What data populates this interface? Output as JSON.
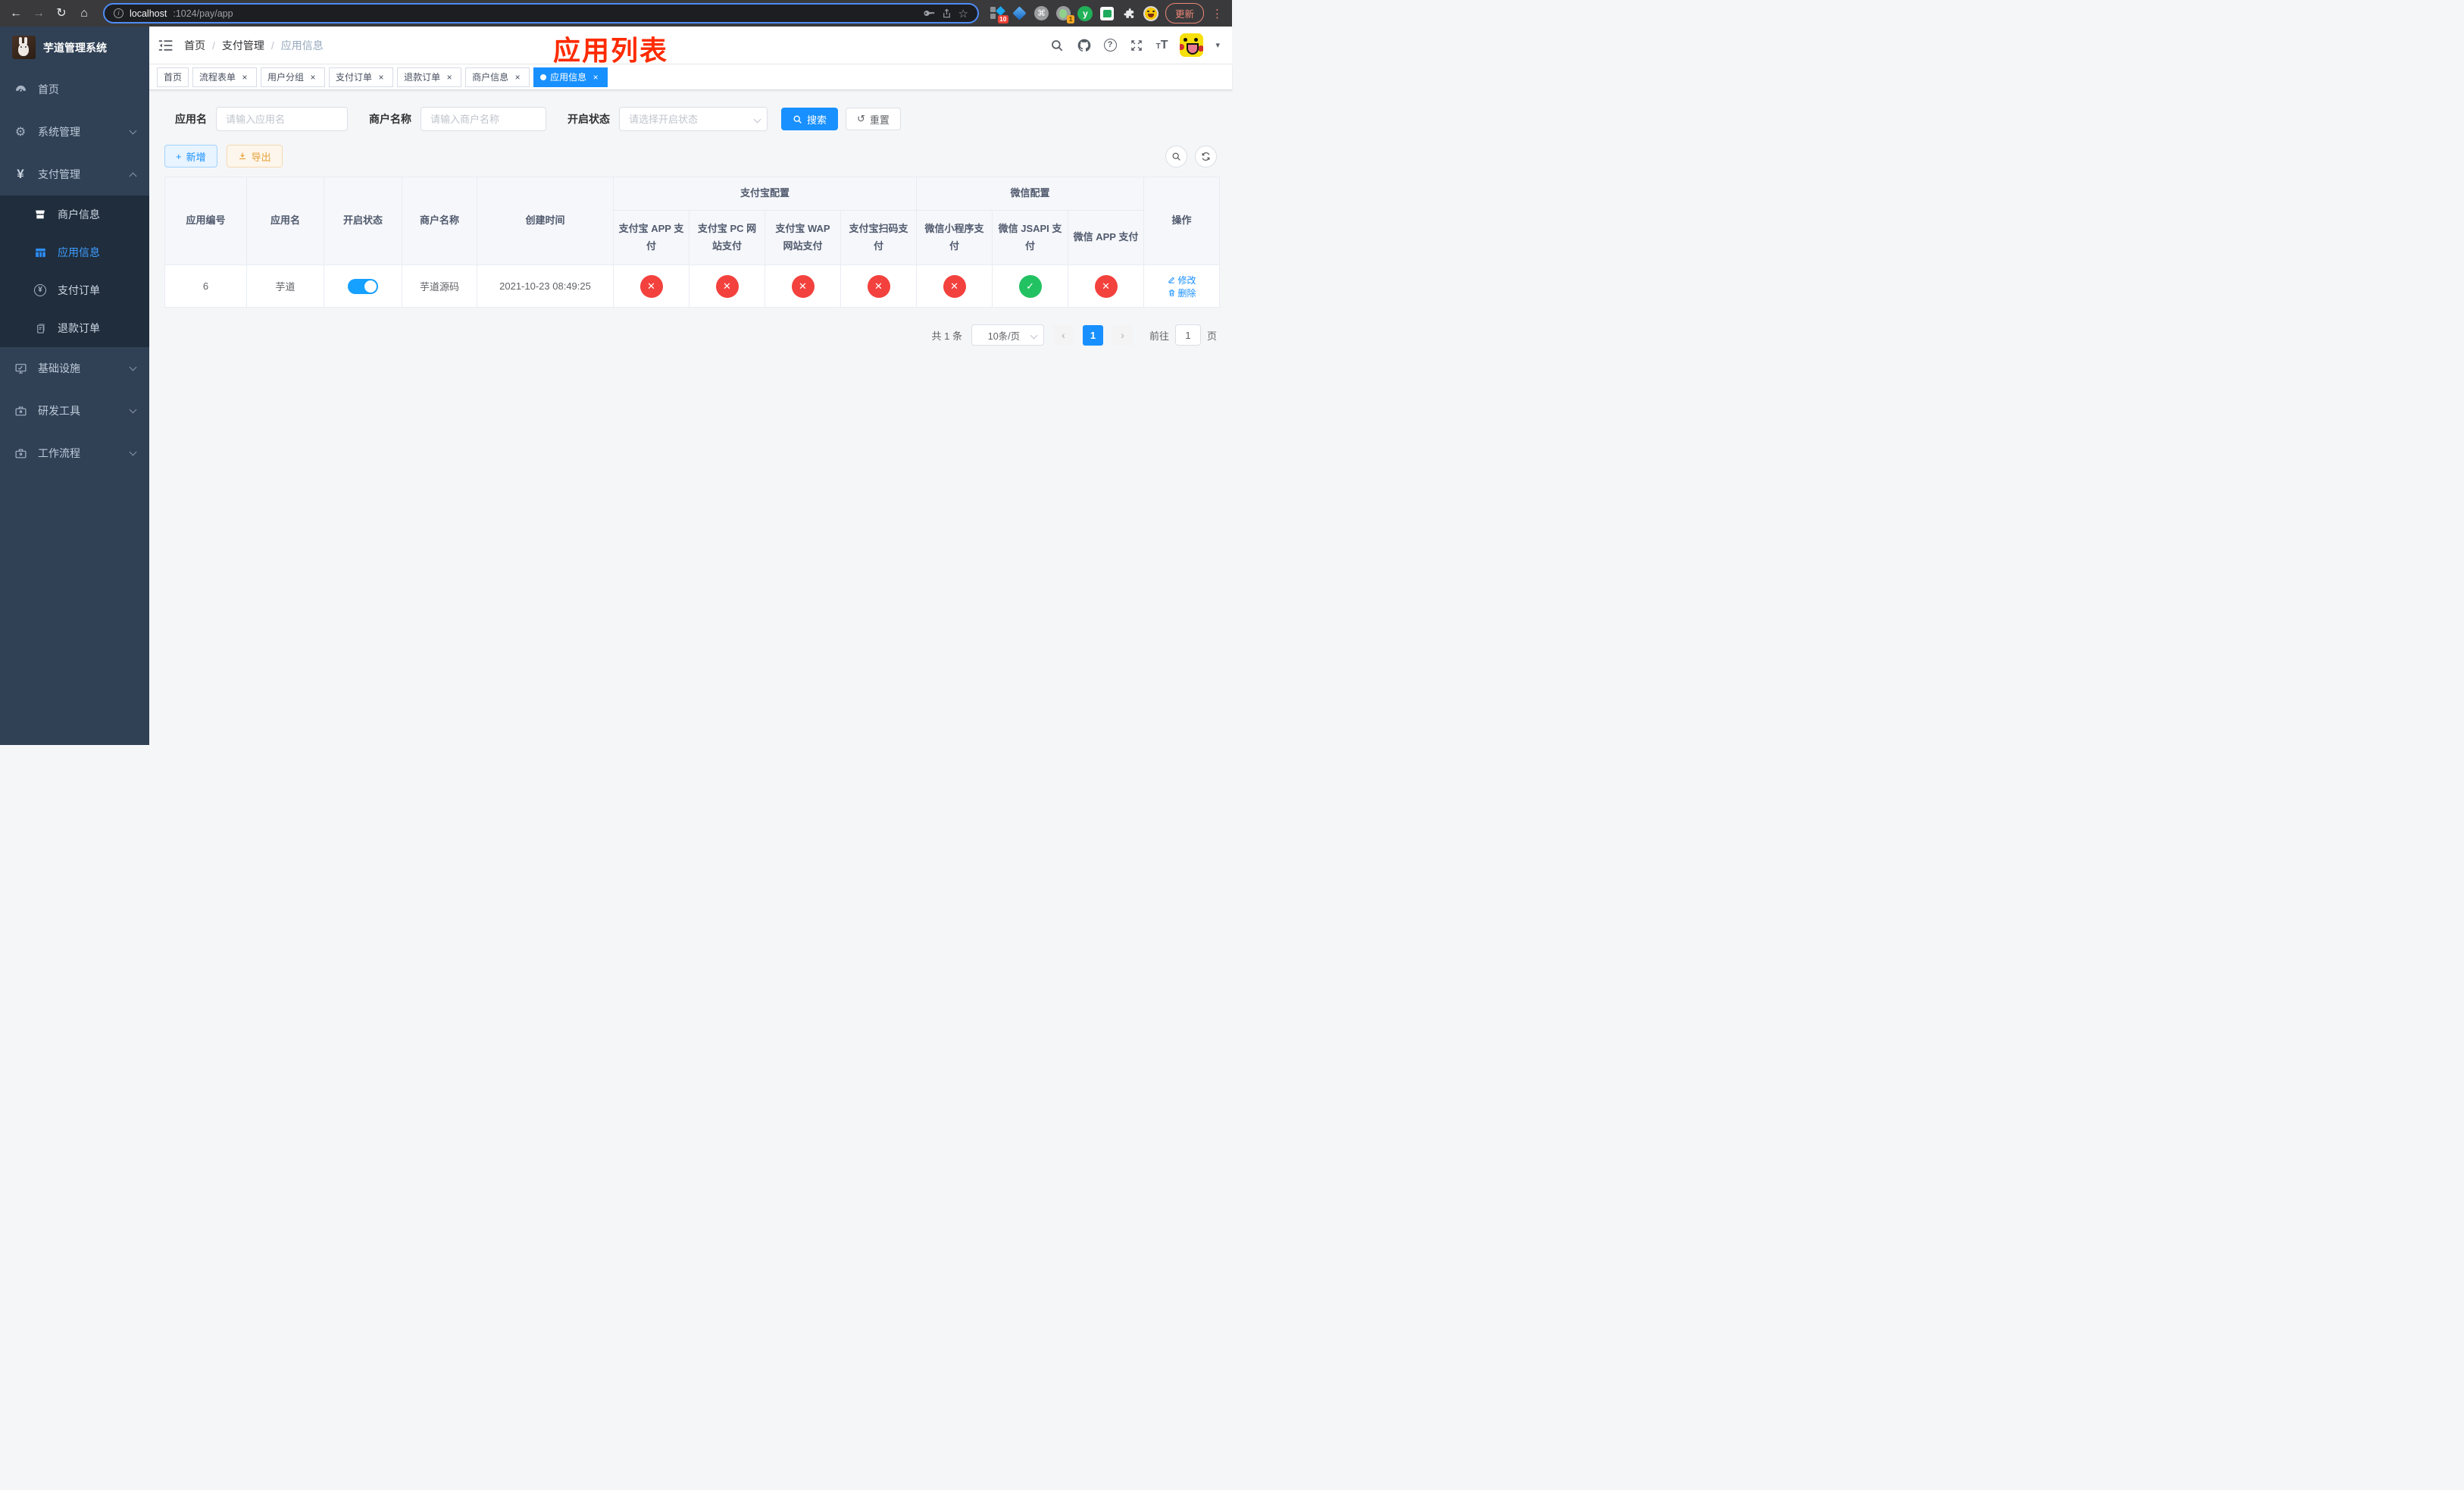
{
  "browser": {
    "url_host": "localhost",
    "url_path": ":1024/pay/app",
    "update_label": "更新",
    "ext_badge_grid": "10",
    "ext_badge_session": "1",
    "ext_y_letter": "y"
  },
  "icons": {
    "back": "←",
    "forward": "→",
    "refresh": "↻",
    "home": "⌂",
    "star": "☆",
    "cmd": "⌘",
    "kebab": "⋮",
    "caret_down": "▾",
    "info": "i",
    "help": "?",
    "close": "×",
    "check": "✓",
    "cross": "✕",
    "plus": "+",
    "reset": "↺",
    "prev": "‹",
    "next": "›",
    "yen": "¥"
  },
  "sidebar": {
    "title": "芋道管理系统",
    "items": [
      {
        "label": "首页",
        "icon": "dashboard-icon"
      },
      {
        "label": "系统管理",
        "icon": "gear-icon"
      },
      {
        "label": "支付管理",
        "icon": "yen-icon"
      },
      {
        "label": "基础设施",
        "icon": "monitor-icon"
      },
      {
        "label": "研发工具",
        "icon": "briefcase-icon"
      },
      {
        "label": "工作流程",
        "icon": "briefcase-icon"
      }
    ],
    "pay_children": [
      {
        "label": "商户信息"
      },
      {
        "label": "应用信息"
      },
      {
        "label": "支付订单"
      },
      {
        "label": "退款订单"
      }
    ]
  },
  "header": {
    "breadcrumb": [
      "首页",
      "支付管理",
      "应用信息"
    ],
    "annotation": "应用列表"
  },
  "tabs": [
    {
      "label": "首页"
    },
    {
      "label": "流程表单"
    },
    {
      "label": "用户分组"
    },
    {
      "label": "支付订单"
    },
    {
      "label": "退款订单"
    },
    {
      "label": "商户信息"
    },
    {
      "label": "应用信息"
    }
  ],
  "filters": {
    "app_name_label": "应用名",
    "app_name_placeholder": "请输入应用名",
    "merchant_label": "商户名称",
    "merchant_placeholder": "请输入商户名称",
    "status_label": "开启状态",
    "status_placeholder": "请选择开启状态",
    "search_label": "搜索",
    "reset_label": "重置"
  },
  "toolbar": {
    "add_label": "新增",
    "export_label": "导出"
  },
  "table": {
    "columns": [
      "应用编号",
      "应用名",
      "开启状态",
      "商户名称",
      "创建时间"
    ],
    "alipay_group": {
      "label": "支付宝配置",
      "columns": [
        "支付宝 APP 支付",
        "支付宝 PC 网站支付",
        "支付宝 WAP 网站支付",
        "支付宝扫码支付"
      ]
    },
    "wechat_group": {
      "label": "微信配置",
      "columns": [
        "微信小程序支付",
        "微信 JSAPI 支付",
        "微信 APP 支付"
      ]
    },
    "actions_label": "操作",
    "rows": [
      {
        "id": "6",
        "name": "芋道",
        "enabled": true,
        "merchant": "芋道源码",
        "created": "2021-10-23 08:49:25",
        "statuses": [
          "no",
          "no",
          "no",
          "no",
          "no",
          "yes",
          "no"
        ],
        "edit_label": "修改",
        "delete_label": "删除"
      }
    ]
  },
  "pagination": {
    "total_text": "共 1 条",
    "page_size": "10条/页",
    "current_page": "1",
    "goto_label": "前往",
    "goto_value": "1",
    "goto_suffix": "页"
  },
  "colors": {
    "primary": "#1890ff",
    "sidebar_bg": "#304156",
    "submenu_bg": "#1f2d3d",
    "sidebar_active": "#409eff",
    "status_off": "#f3413d",
    "status_on": "#22c262",
    "annotation_red": "#fe2b01",
    "export_orange": "#e6a23c",
    "urlbar_focus": "#4e8cf7",
    "update_salmon": "#ee8677"
  }
}
